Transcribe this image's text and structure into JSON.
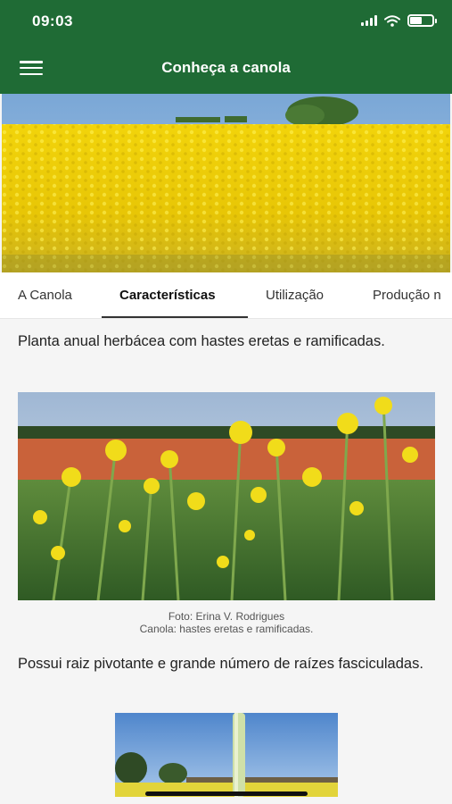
{
  "status_bar": {
    "time": "09:03"
  },
  "app_bar": {
    "title": "Conheça a canola",
    "menu_icon": "hamburger-menu-icon"
  },
  "tabs": [
    {
      "label": "A Canola",
      "active": false
    },
    {
      "label": "Características",
      "active": true
    },
    {
      "label": "Utilização",
      "active": false
    },
    {
      "label": "Produção n",
      "active": false
    }
  ],
  "content": {
    "paragraph_1": "Planta anual herbácea com hastes eretas e ramificadas.",
    "photo_credit": "Foto: Erina V. Rodrigues",
    "photo_caption": "Canola: hastes eretas e ramificadas.",
    "paragraph_2": "Possui raiz pivotante e grande número de raízes fasciculadas."
  },
  "colors": {
    "app_bar": "#1f6b35",
    "flower_yellow": "#f5d90a"
  }
}
